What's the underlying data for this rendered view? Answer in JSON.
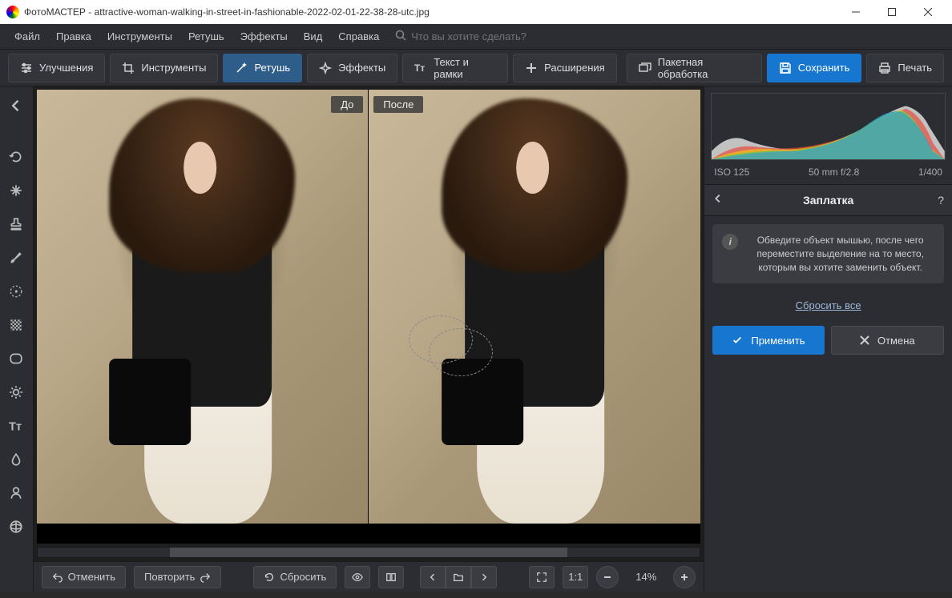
{
  "window": {
    "app_name": "ФотоМАСТЕР",
    "file_name": "attractive-woman-walking-in-street-in-fashionable-2022-02-01-22-38-28-utc.jpg"
  },
  "menu": {
    "items": [
      "Файл",
      "Правка",
      "Инструменты",
      "Ретушь",
      "Эффекты",
      "Вид",
      "Справка"
    ],
    "search_placeholder": "Что вы хотите сделать?"
  },
  "toolbar": {
    "enhance": "Улучшения",
    "tools": "Инструменты",
    "retouch": "Ретушь",
    "effects": "Эффекты",
    "text": "Текст и рамки",
    "extensions": "Расширения",
    "batch": "Пакетная обработка",
    "save": "Сохранить",
    "print": "Печать"
  },
  "canvas": {
    "before_label": "До",
    "after_label": "После"
  },
  "meta": {
    "iso": "ISO 125",
    "lens": "50 mm f/2.8",
    "shutter": "1/400"
  },
  "panel": {
    "title": "Заплатка",
    "info_text": "Обведите объект мышью, после чего переместите выделение на то место, которым вы хотите заменить объект.",
    "reset_all": "Сбросить все",
    "apply": "Применить",
    "cancel": "Отмена"
  },
  "bottom": {
    "undo": "Отменить",
    "redo": "Повторить",
    "reset": "Сбросить",
    "ratio": "1:1",
    "zoom": "14%"
  }
}
